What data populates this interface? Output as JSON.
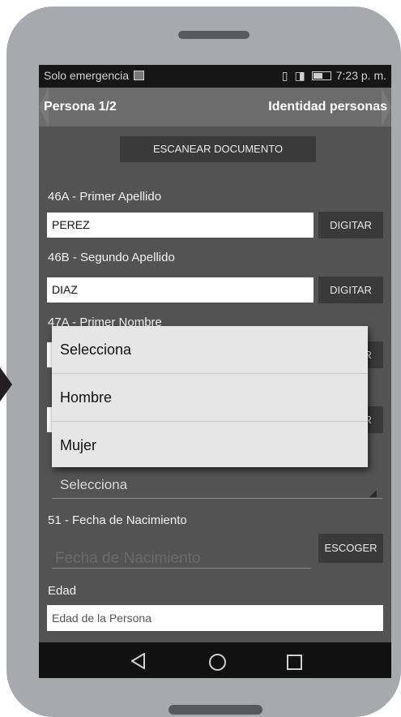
{
  "status_bar": {
    "carrier": "Solo emergencia",
    "time": "7:23 p. m."
  },
  "header": {
    "left_title": "Persona 1/2",
    "right_title": "Identidad personas"
  },
  "scan_button": "ESCANEAR DOCUMENTO",
  "fields": [
    {
      "label": "46A - Primer Apellido",
      "value": "PEREZ",
      "button": "DIGITAR"
    },
    {
      "label": "46B - Segundo Apellido",
      "value": "DIAZ",
      "button": "DIGITAR"
    },
    {
      "label": "47A - Primer Nombre",
      "button": "DIGITAR"
    },
    {
      "button": "DIGITAR"
    }
  ],
  "sex_select": {
    "selected": "Selecciona"
  },
  "birth_date": {
    "label": "51 - Fecha de Nacimiento",
    "placeholder": "Fecha de Nacimiento",
    "button": "ESCOGER"
  },
  "age": {
    "label": "Edad",
    "placeholder": "Edad de la Persona"
  },
  "dropdown": {
    "options": [
      "Selecciona",
      "Hombre",
      "Mujer"
    ]
  },
  "nav_icons": [
    "back-icon",
    "home-icon",
    "recents-icon"
  ]
}
